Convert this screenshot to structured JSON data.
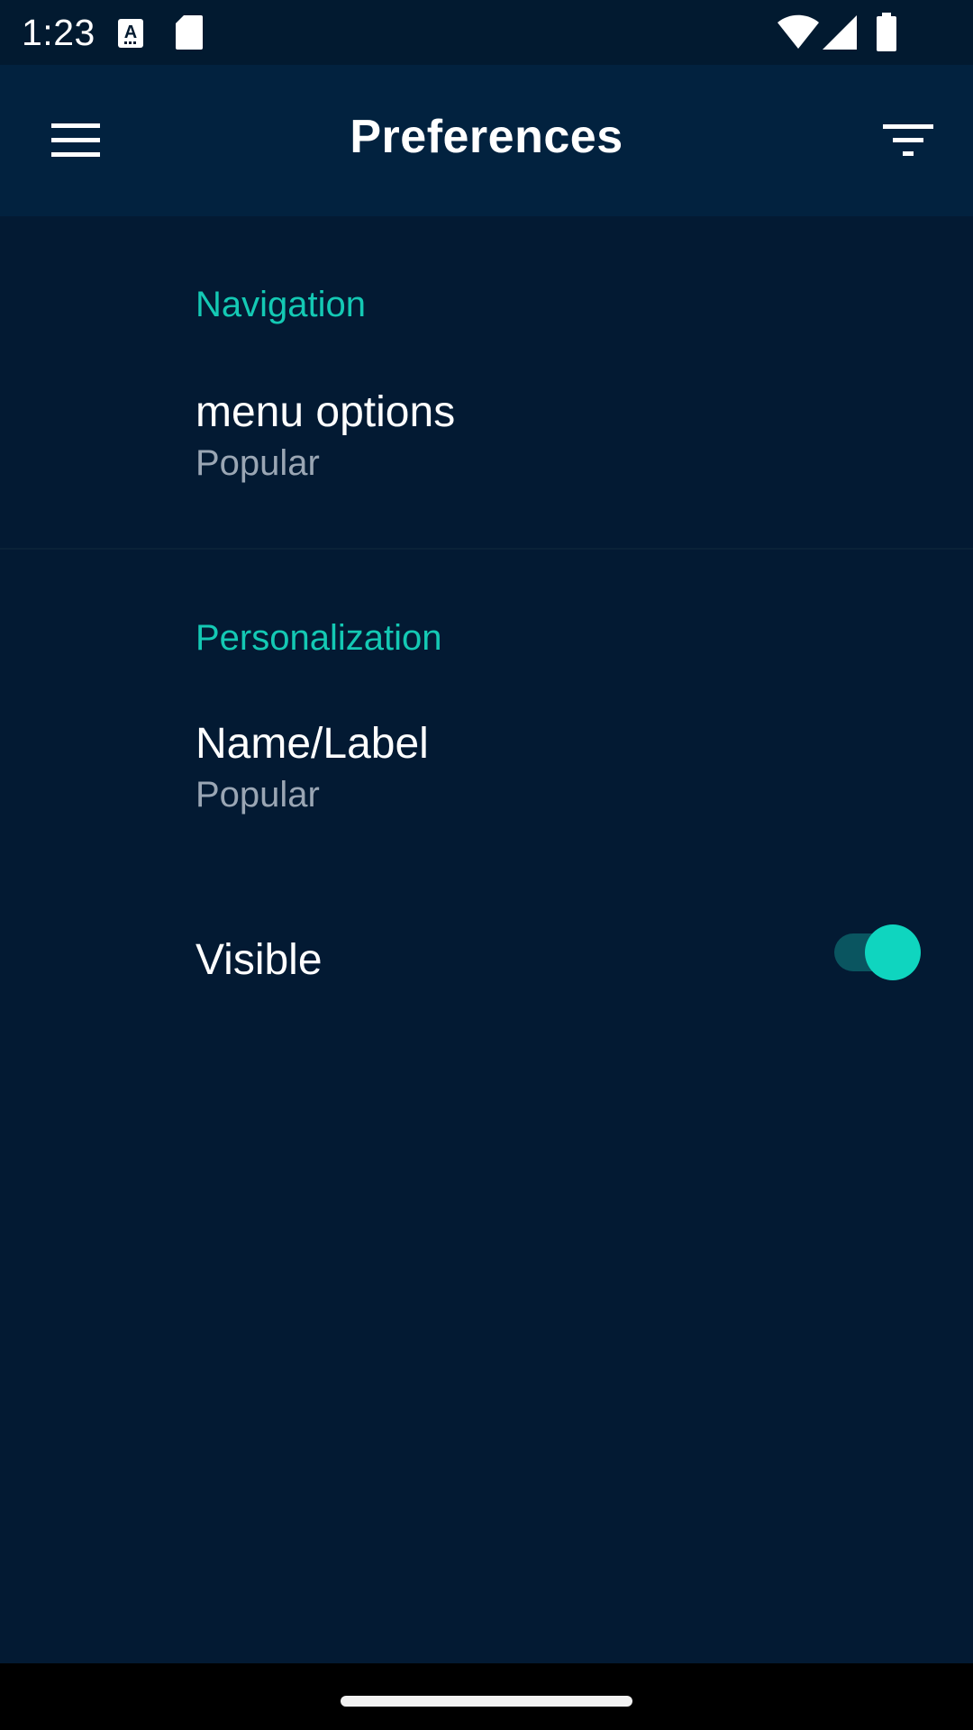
{
  "status_bar": {
    "time": "1:23",
    "icons": [
      "keyboard-a-icon",
      "sd-card-icon",
      "wifi-icon",
      "cell-signal-icon",
      "battery-icon"
    ]
  },
  "app_bar": {
    "title": "Preferences",
    "left_icon": "menu-icon",
    "right_icon": "filter-icon"
  },
  "sections": [
    {
      "header": "Navigation",
      "items": [
        {
          "title": "menu options",
          "summary": "Popular"
        }
      ]
    },
    {
      "header": "Personalization",
      "items": [
        {
          "title": "Name/Label",
          "summary": "Popular"
        },
        {
          "title": "Visible",
          "toggle_on": true
        }
      ]
    }
  ],
  "colors": {
    "background": "#031a33",
    "app_bar": "#02223f",
    "accent": "#14c9b4",
    "summary_text": "#9aa6b4"
  }
}
